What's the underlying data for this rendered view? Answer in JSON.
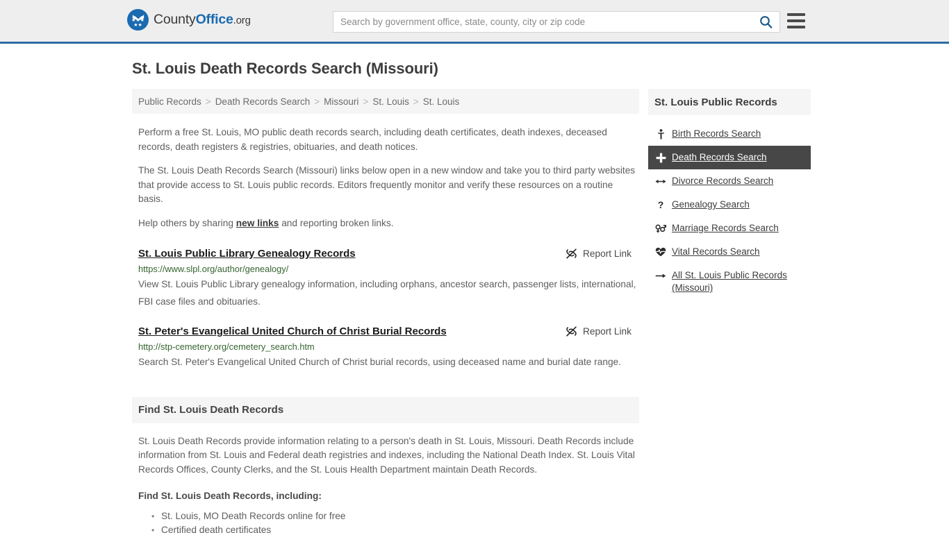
{
  "header": {
    "brand": {
      "part1": "County",
      "part2": "Office",
      "part3": ".org"
    },
    "search": {
      "placeholder": "Search by government office, state, county, city or zip code",
      "value": "",
      "search_icon": "search-icon",
      "menu_icon": "hamburger-menu-icon"
    }
  },
  "page": {
    "title": "St. Louis Death Records Search (Missouri)",
    "breadcrumb": [
      "Public Records",
      "Death Records Search",
      "Missouri",
      "St. Louis",
      "St. Louis"
    ],
    "breadcrumb_separator": ">",
    "intro": {
      "p1": "Perform a free St. Louis, MO public death records search, including death certificates, death indexes, deceased records, death registers & registries, obituaries, and death notices.",
      "p2": "The St. Louis Death Records Search (Missouri) links below open in a new window and take you to third party websites that provide access to St. Louis public records. Editors frequently monitor and verify these resources on a routine basis.",
      "p3_before": "Help others by sharing ",
      "p3_link": "new links",
      "p3_after": " and reporting broken links."
    },
    "results": [
      {
        "title": "St. Louis Public Library Genealogy Records",
        "url": "https://www.slpl.org/author/genealogy/",
        "description": "View St. Louis Public Library genealogy information, including orphans, ancestor search, passenger lists, international, FBI case files and obituaries.",
        "report_label": "Report Link",
        "report_icon": "broken-link-icon"
      },
      {
        "title": "St. Peter's Evangelical United Church of Christ Burial Records",
        "url": "http://stp-cemetery.org/cemetery_search.htm",
        "description": "Search St. Peter's Evangelical United Church of Christ burial records, using deceased name and burial date range.",
        "report_label": "Report Link",
        "report_icon": "broken-link-icon"
      }
    ],
    "find_section": {
      "heading": "Find St. Louis Death Records",
      "paragraph": "St. Louis Death Records provide information relating to a person's death in St. Louis, Missouri. Death Records include information from St. Louis and Federal death registries and indexes, including the National Death Index. St. Louis Vital Records Offices, County Clerks, and the St. Louis Health Department maintain Death Records.",
      "subheading": "Find St. Louis Death Records, including:",
      "bullets": [
        "St. Louis, MO Death Records online for free",
        "Certified death certificates"
      ]
    }
  },
  "sidebar": {
    "heading": "St. Louis Public Records",
    "items": [
      {
        "label": "Birth Records Search",
        "icon": "child-icon",
        "glyph": "\u0001",
        "active": false
      },
      {
        "label": "Death Records Search",
        "icon": "plus-cross-icon",
        "glyph": "✚",
        "active": true
      },
      {
        "label": "Divorce Records Search",
        "icon": "left-right-arrows-icon",
        "glyph": "↔",
        "active": false
      },
      {
        "label": "Genealogy Search",
        "icon": "question-mark-icon",
        "glyph": "?",
        "active": false
      },
      {
        "label": "Marriage Records Search",
        "icon": "venus-mars-icon",
        "glyph": "⚥",
        "active": false
      },
      {
        "label": "Vital Records Search",
        "icon": "heartbeat-icon",
        "glyph": "♥",
        "active": false
      },
      {
        "label": "All St. Louis Public Records (Missouri)",
        "icon": "arrow-right-icon",
        "glyph": "→",
        "active": false
      }
    ]
  },
  "colors": {
    "brand_blue": "#1a6ab0",
    "header_border": "#2b6ca3",
    "header_bg": "#eeeeee",
    "panel_bg": "#f5f5f5",
    "active_bg": "#474747",
    "url_green": "#35642f",
    "body_text": "#5e5e5e"
  }
}
